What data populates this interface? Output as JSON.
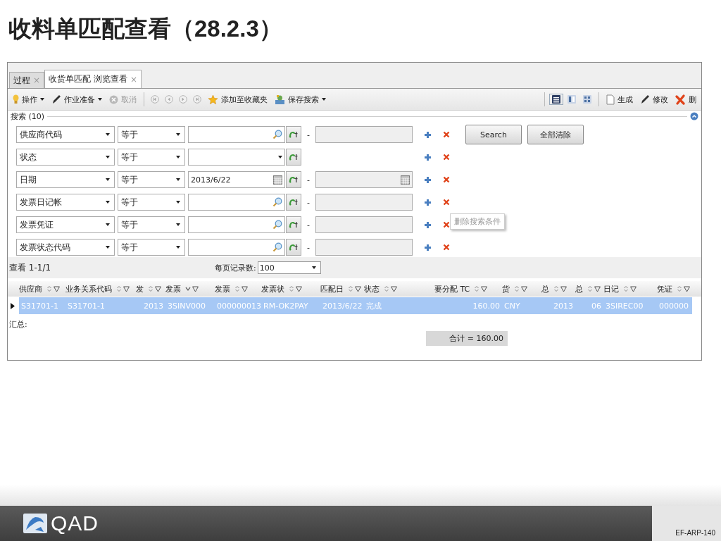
{
  "slide_title": "收料单匹配查看（28.2.3）",
  "tabs": [
    {
      "label": "过程",
      "close": "×",
      "selected": false
    },
    {
      "label": "收货单匹配 浏览查看",
      "close": "×",
      "selected": true
    }
  ],
  "toolbar": {
    "left": [
      {
        "label": "操作",
        "dropdown": true,
        "disabled": false
      },
      {
        "label": "作业准备",
        "dropdown": true,
        "disabled": false
      },
      {
        "label": "取消",
        "dropdown": false,
        "disabled": true
      }
    ],
    "nav_buttons": [
      {
        "disabled": true
      },
      {
        "disabled": true
      },
      {
        "disabled": true
      },
      {
        "disabled": true
      }
    ],
    "extra": [
      {
        "label": "添加至收藏夹",
        "dropdown": false
      },
      {
        "label": "保存搜索",
        "dropdown": true
      }
    ],
    "view_buttons": [
      {
        "selected": true
      },
      {
        "selected": false
      },
      {
        "selected": false
      }
    ],
    "right": [
      {
        "label": "生成"
      },
      {
        "label": "修改"
      },
      {
        "label": "删"
      }
    ]
  },
  "search": {
    "title": "搜索 (10)",
    "rows": [
      {
        "kind": "lookup",
        "field": "供应商代码",
        "operator": "等于",
        "separator": "-"
      },
      {
        "kind": "list",
        "field": "状态",
        "operator": "等于"
      },
      {
        "kind": "date",
        "field": "日期",
        "operator": "等于",
        "value": "2013/6/22",
        "separator": "-"
      },
      {
        "kind": "lookup",
        "field": "发票日记帐",
        "operator": "等于",
        "separator": "-"
      },
      {
        "kind": "lookup",
        "field": "发票凭证",
        "operator": "等于",
        "separator": "-"
      },
      {
        "kind": "lookup",
        "field": "发票状态代码",
        "operator": "等于",
        "separator": "-"
      }
    ],
    "buttons": [
      "Search",
      "全部清除"
    ],
    "tooltip": "删除搜索条件"
  },
  "pager": {
    "range": "查看 1-1/1",
    "per_page_label": "每页记录数:",
    "per_page": "100"
  },
  "table": {
    "columns": [
      {
        "label": "供应商",
        "sorted": false
      },
      {
        "label": "业务关系代码",
        "sorted": false
      },
      {
        "label": "发",
        "sorted": false
      },
      {
        "label": "发票",
        "sorted": true
      },
      {
        "label": "发票",
        "sorted": false
      },
      {
        "label": "发票状",
        "sorted": false
      },
      {
        "label": "匹配日",
        "sorted": false
      },
      {
        "label": "状态",
        "sorted": false
      },
      {
        "label": "要分配 TC",
        "sorted": false
      },
      {
        "label": "货",
        "sorted": false
      },
      {
        "label": "总",
        "sorted": false
      },
      {
        "label": "总",
        "sorted": false
      },
      {
        "label": "日记",
        "sorted": false
      },
      {
        "label": "凭证",
        "sorted": false
      }
    ],
    "rows": [
      {
        "selected": true,
        "cells": [
          "S31701-1",
          "S31701-1",
          "2013",
          "3SINV000",
          "000000013",
          "RM-OK2PAY",
          "2013/6/22",
          "完成",
          "160.00",
          "CNY",
          "2013",
          "06",
          "3SIREC00",
          "000000"
        ]
      }
    ],
    "summary_label": "汇总:",
    "total": "合计 = 160.00"
  },
  "footer": {
    "logo": "QAD",
    "code": "EF-ARP-140"
  }
}
